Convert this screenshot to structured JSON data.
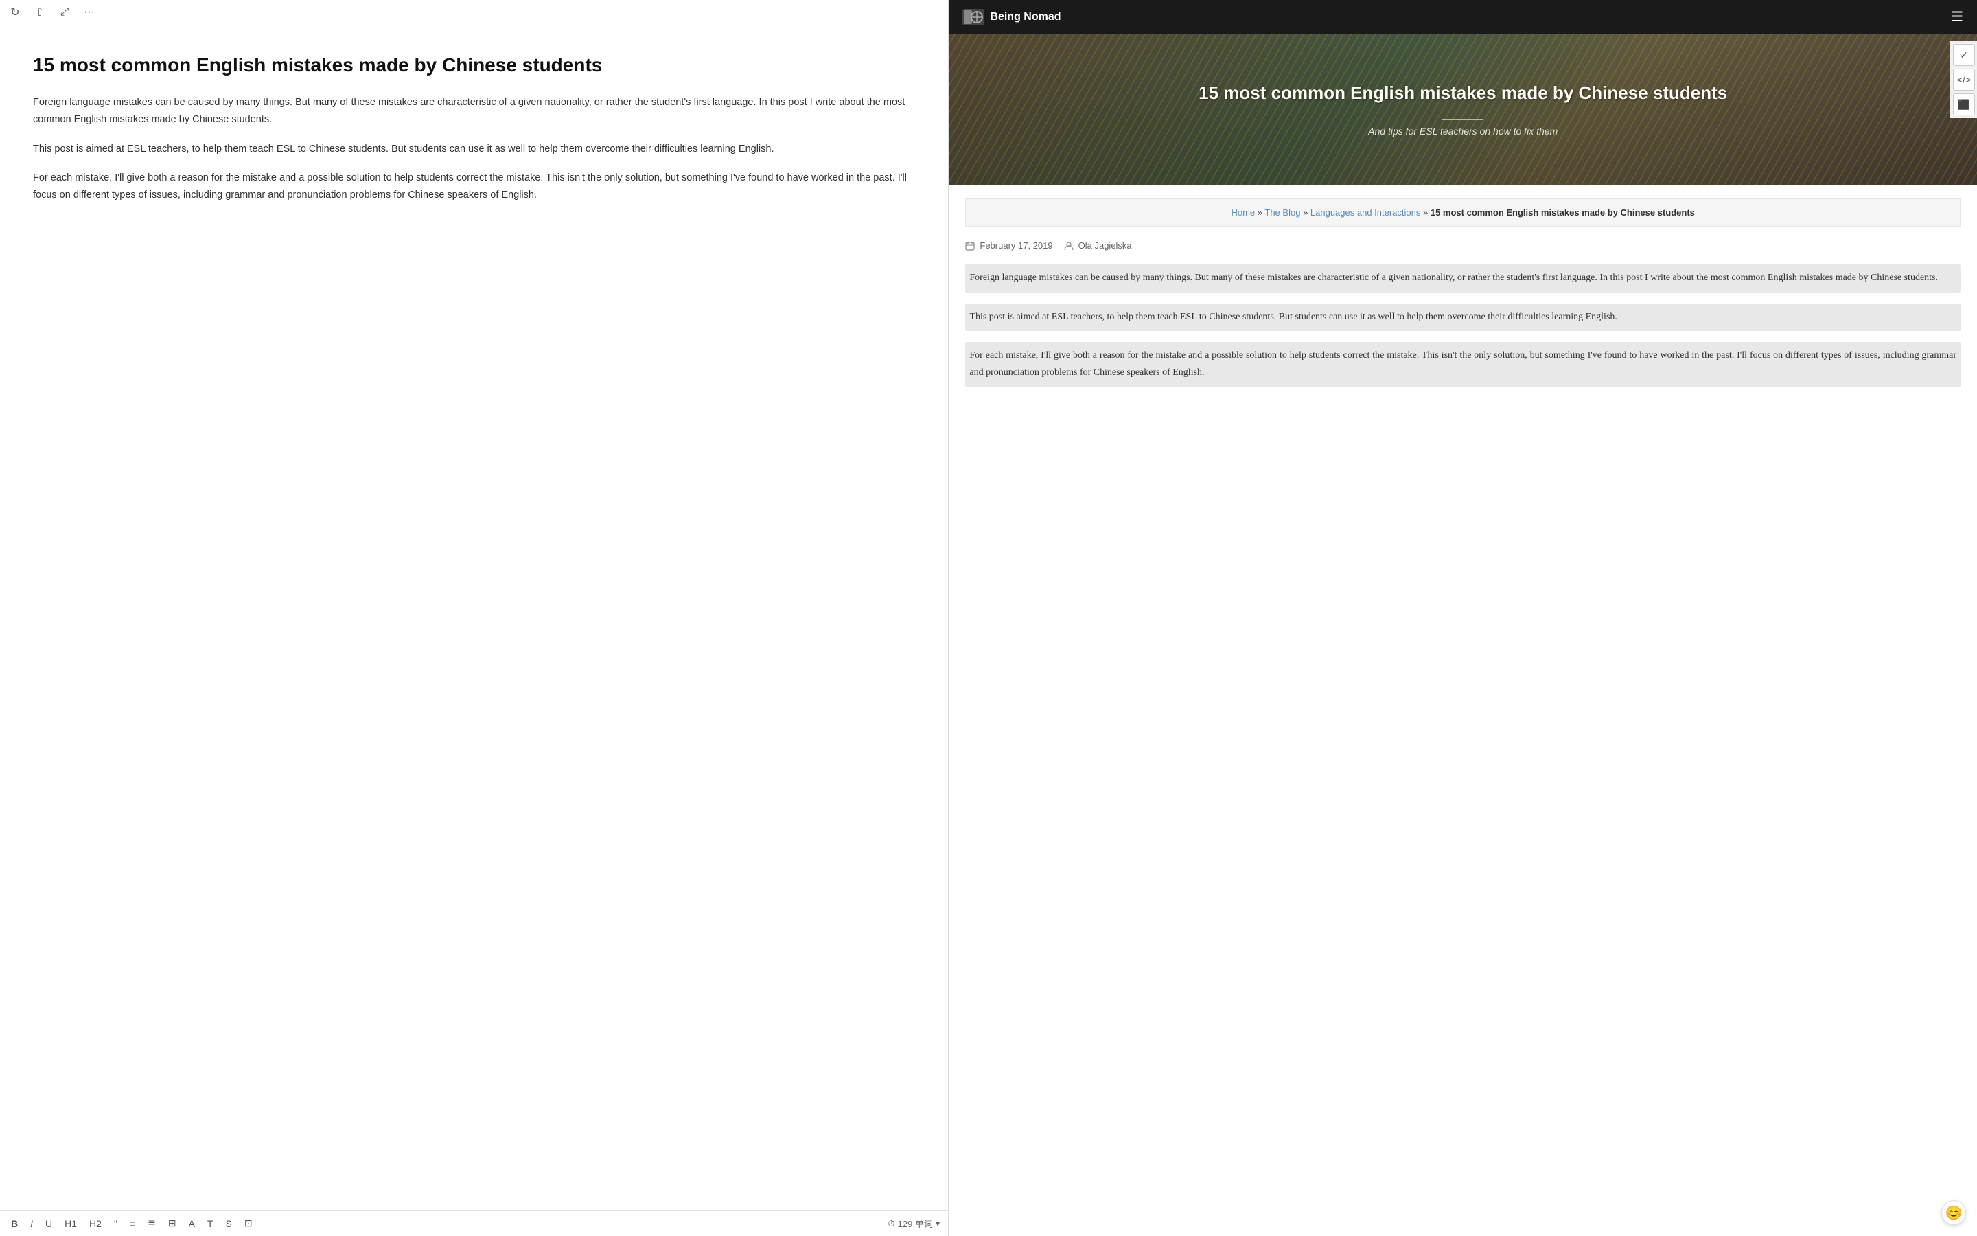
{
  "left": {
    "toolbar": {
      "refresh_icon": "↻",
      "share_icon": "⇧",
      "expand_icon": "⤢",
      "more_icon": "···"
    },
    "article": {
      "title": "15 most common English mistakes made by Chinese students",
      "paragraphs": [
        "Foreign language mistakes can be caused by many things. But many of these mistakes are characteristic of a given nationality, or rather the student's first language. In this post I write about the most common English mistakes made by Chinese students.",
        "This post is aimed at ESL teachers, to help them teach ESL to Chinese students. But students can use it as well to help them overcome their difficulties learning English.",
        "For each mistake, I'll give both a reason for the mistake and a possible solution to help students correct the mistake. This isn't the only solution, but something I've found to have worked in the past. I'll focus on different types of issues, including grammar and pronunciation problems for Chinese speakers of English."
      ]
    },
    "bottom_toolbar": {
      "bold": "B",
      "italic": "I",
      "underline": "U",
      "heading1": "H1",
      "heading2": "H2",
      "quote": "\"",
      "list_bullet": "≡",
      "list_number": "≣",
      "link": "⊞",
      "underline2": "A",
      "typewriter": "T",
      "strikethrough": "S",
      "image": "⊡",
      "word_count_label": "129 单词",
      "clock_icon": "⏱"
    }
  },
  "right": {
    "header": {
      "logo_text": "Being Nomad",
      "logo_icon": "🌍",
      "menu_icon": "☰"
    },
    "hero": {
      "title": "15 most common English mistakes made by Chinese students",
      "subtitle": "And tips for ESL teachers on how to fix them"
    },
    "breadcrumb": {
      "home": "Home",
      "blog": "The Blog",
      "category": "Languages and Interactions",
      "current": "15 most common English mistakes made by Chinese students"
    },
    "meta": {
      "date": "February 17, 2019",
      "author": "Ola Jagielska"
    },
    "paragraphs": [
      "Foreign language mistakes can be caused by many things. But many of these mistakes are characteristic of a given nationality, or rather the student's first language. In this post I write about the most common English mistakes made by Chinese students.",
      "This post is aimed at ESL teachers, to help them teach ESL to Chinese students. But students can use it as well to help them overcome their difficulties learning English.",
      "For each mistake, I'll give both a reason for the mistake and a possible solution to help students correct the mistake. This isn't the only solution, but something I've found to have worked in the past. I'll focus on different types of issues, including grammar and pronunciation problems for Chinese speakers of English."
    ],
    "sidebar_icons": {
      "check": "✓",
      "code": "</>"
    },
    "layer_icon": "⬛",
    "emoji": "😊"
  }
}
